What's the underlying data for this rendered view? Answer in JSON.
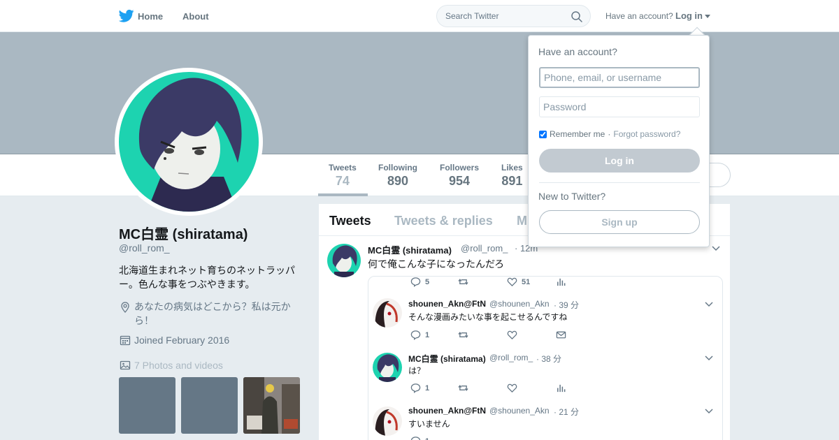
{
  "nav": {
    "home_label": "Home",
    "about_label": "About",
    "search_placeholder": "Search Twitter",
    "have_account": "Have an account?",
    "login_label": "Log in"
  },
  "profile": {
    "name": "MC白霊 (shiratama)",
    "handle": "@roll_rom_",
    "bio": "北海道生まれネット育ちのネットラッパー。色んな事をつぶやきます。",
    "location": "あなたの病気はどこから？私は元から！",
    "joined": "Joined February 2016",
    "photos_label": "7 Photos and videos"
  },
  "stats": [
    {
      "label": "Tweets",
      "value": "74"
    },
    {
      "label": "Following",
      "value": "890"
    },
    {
      "label": "Followers",
      "value": "954"
    },
    {
      "label": "Likes",
      "value": "891"
    }
  ],
  "tabs": [
    "Tweets",
    "Tweets & replies",
    "M"
  ],
  "tweet": {
    "name": "MC白霊 (shiratama)",
    "handle": "@roll_rom_",
    "time": "· 12m",
    "text": "何で俺こんな子になったんだろ"
  },
  "quoted": {
    "top_actions": {
      "reply": "5",
      "like": "51"
    },
    "replies": [
      {
        "name": "shounen_Akn@FtN",
        "handle": "@shounen_Akn",
        "time": "· 39 分",
        "text": "そんな漫画みたいな事を起こせるんですね",
        "reply_count": "1"
      },
      {
        "name": "MC白霊 (shiratama)",
        "handle": "@roll_rom_",
        "time": "· 38 分",
        "text": "は？",
        "reply_count": "1"
      },
      {
        "name": "shounen_Akn@FtN",
        "handle": "@shounen_Akn",
        "time": "· 21 分",
        "text": "すいません",
        "reply_count": "1"
      }
    ]
  },
  "login_dropdown": {
    "title": "Have an account?",
    "username_placeholder": "Phone, email, or username",
    "password_placeholder": "Password",
    "remember_label": "Remember me",
    "separator": " · ",
    "forgot_label": "Forgot password?",
    "login_button": "Log in",
    "new_label": "New to Twitter?",
    "signup_button": "Sign up"
  },
  "colors": {
    "banner": "#aab8c2",
    "twitter_blue": "#1da1f2",
    "avatar_bg": "#1dd3b0",
    "hair": "#3b3a66"
  }
}
